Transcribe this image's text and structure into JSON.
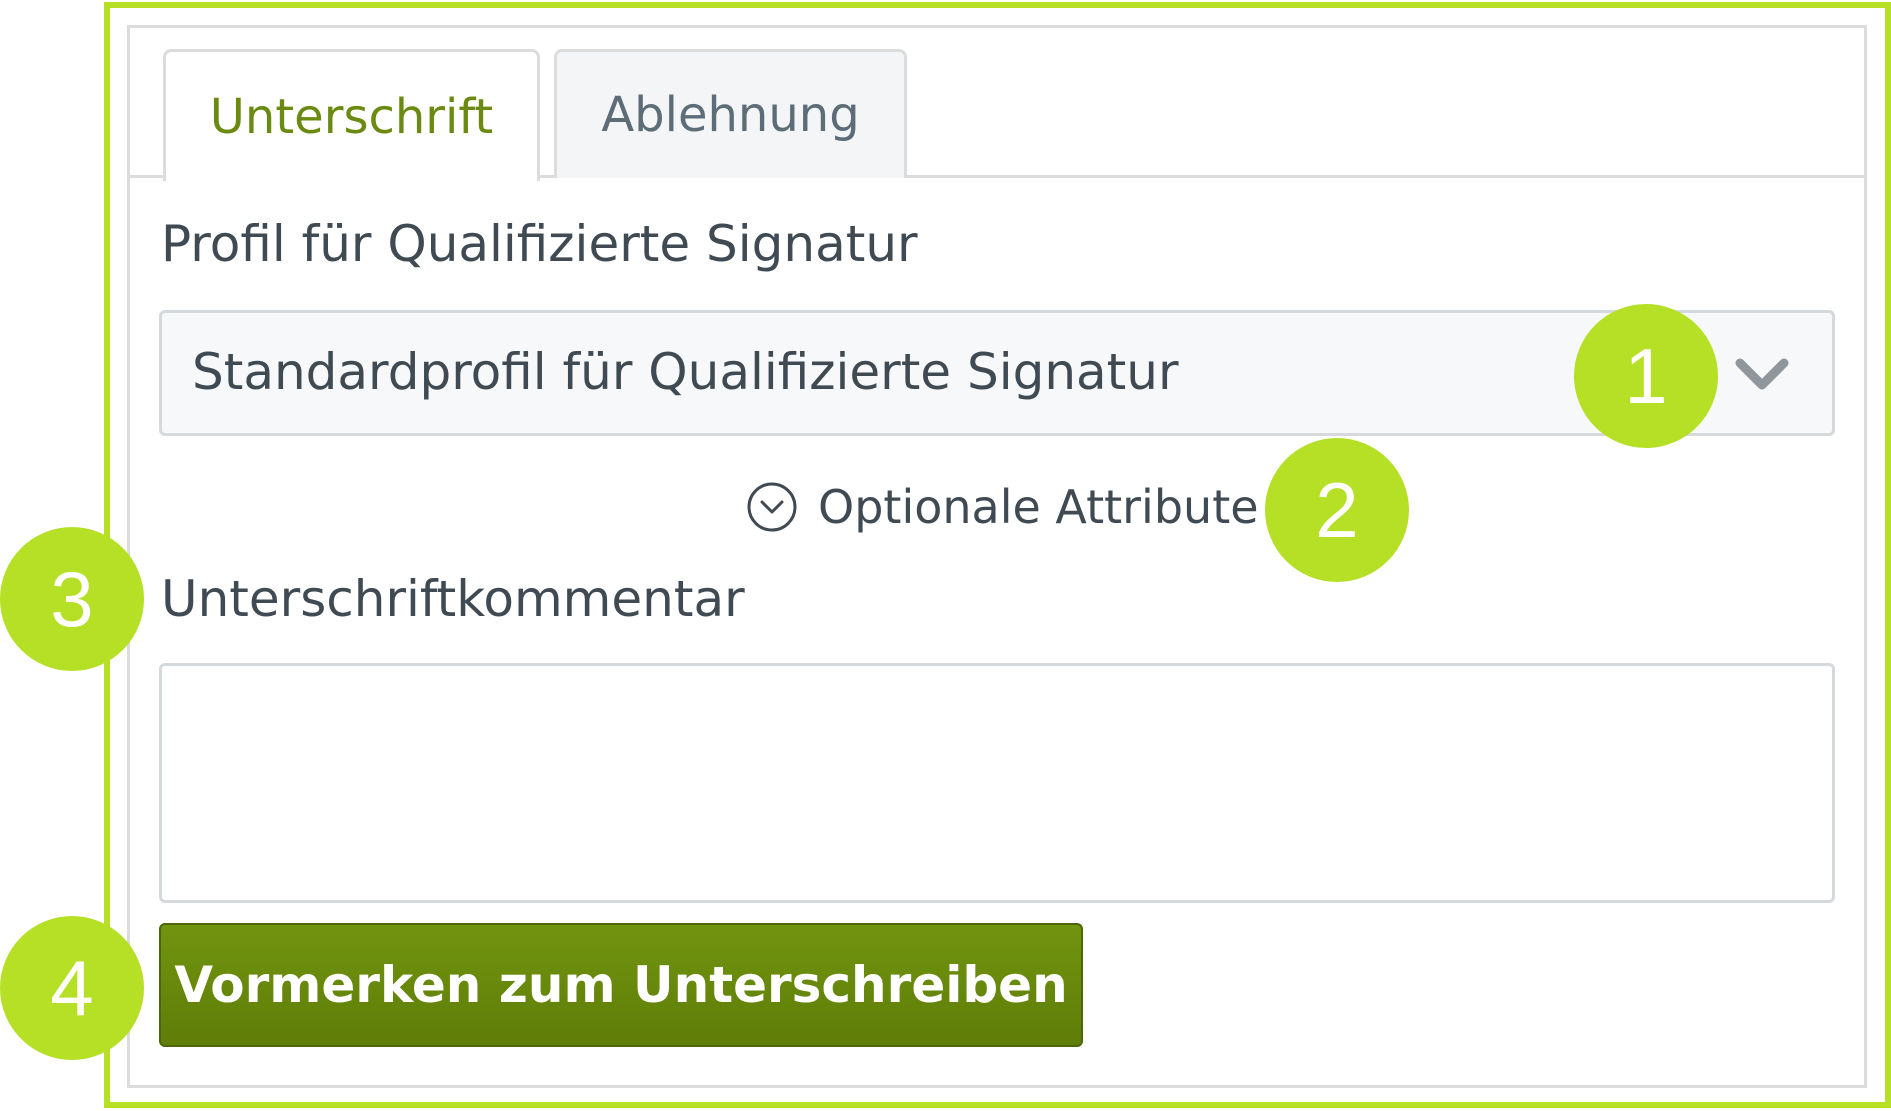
{
  "tabs": [
    {
      "label": "Unterschrift",
      "active": true
    },
    {
      "label": "Ablehnung",
      "active": false
    }
  ],
  "profile": {
    "label": "Profil für Qualifizierte Signatur",
    "selected": "Standardprofil für Qualifizierte Signatur",
    "chevron_icon": "chevron-down-icon"
  },
  "optional_attributes": {
    "label": "Optionale Attribute",
    "icon": "circle-chevron-down-icon"
  },
  "comment": {
    "label": "Unterschriftkommentar",
    "value": "",
    "placeholder": ""
  },
  "submit": {
    "label": "Vormerken zum Unterschreiben"
  },
  "badges": [
    "1",
    "2",
    "3",
    "4"
  ],
  "colors": {
    "annotation": "#b5e025",
    "active_tab_text": "#6b8a12",
    "primary_button": "#6a8b0c"
  }
}
